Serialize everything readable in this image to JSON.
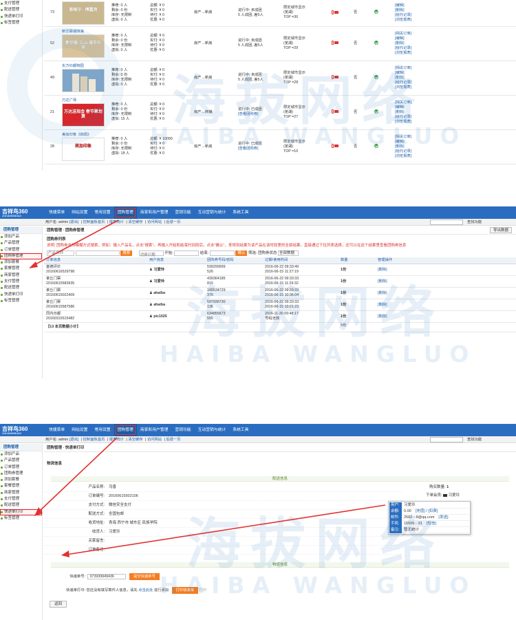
{
  "watermark": {
    "cn": "海拔网络",
    "en": "HAIBA WANGLUO"
  },
  "p1": {
    "sidebar": [
      "支付管理",
      "配送管理",
      "快递单打印",
      "标签管理"
    ],
    "rows": [
      {
        "id": "73",
        "title": "",
        "thumb_text": "恩格尔 · 傅嘉苑",
        "thumb_bg": "#c9b88f",
        "sales": [
          "推荐: 0 人",
          "剩余: 0 份",
          "库存: 无限制",
          "虚拟: 0 人"
        ],
        "money": [
          "总额: ¥ 0",
          "实付: ¥ 0",
          "待付: ¥ 0",
          "优惠: ¥ 0"
        ],
        "type": "房产→新房",
        "status": [
          "进行中: 未成团",
          "5 人成团, 差5人"
        ],
        "loc": "限定城市显示",
        "loc2": "(芜湖)",
        "top": "TOP =30",
        "flag": "否",
        "ops": [
          "编辑",
          "删除",
          "给托记录",
          "浏览报表"
        ]
      },
      {
        "id": "52",
        "title": "新华联城四海",
        "thumb_text": "新华联·三山 城市中央",
        "thumb_bg": "#d9c39a",
        "sales": [
          "推荐: 0 人",
          "剩余: 0 份",
          "库存: 无限制",
          "虚拟: 0 人"
        ],
        "money": [
          "总额: ¥ 0",
          "实付: ¥ 0",
          "待付: ¥ 0",
          "优惠: ¥ 0"
        ],
        "type": "房产→新房",
        "status": [
          "进行中: 未成团",
          "5 人成团, 差5人"
        ],
        "loc": "限定城市显示",
        "loc2": "(芜湖)",
        "top": "TOP =29",
        "flag": "否",
        "ops": [
          "相关订单",
          "编辑",
          "删除",
          "给托记录",
          "浏览报表"
        ]
      },
      {
        "id": "49",
        "title": "东方红都物园",
        "thumb_text": "",
        "thumb_bg": "#7fa6c9",
        "sales": [
          "推荐: 0 人",
          "剩余: 0 份",
          "库存: 无限制",
          "虚拟: 0 人"
        ],
        "money": [
          "总额: ¥ 0",
          "实付: ¥ 0",
          "待付: ¥ 0",
          "优惠: ¥ 0"
        ],
        "type": "房产→新房",
        "status": [
          "进行中: 未成团",
          "5 人成团, 差5人"
        ],
        "loc": "限定城市显示",
        "loc2": "(芜湖)",
        "top": "TOP =28",
        "flag": "否",
        "ops": [
          "相关订单",
          "编辑",
          "删除",
          "给托记录",
          "浏览报表"
        ]
      },
      {
        "id": "21",
        "title": "万达广场",
        "thumb_text": "万达送现金 春节聚划算",
        "thumb_bg": "#d8262b",
        "sales": [
          "推荐: 0 人",
          "剩余: 0 份",
          "库存: 无限制",
          "虚拟: 15 人"
        ],
        "money": [
          "总额: ¥ 0",
          "实付: ¥ 0",
          "待付: ¥ 0",
          "优惠: ¥ 0"
        ],
        "type": "房产→商铺",
        "status": [
          "进行中: 已成团",
          "[查看团购券]"
        ],
        "loc": "限定城市显示",
        "loc2": "(芜湖)",
        "top": "TOP =27",
        "flag": "否",
        "ops": [
          "相关订单",
          "编辑",
          "删除",
          "给托记录",
          "浏览报表"
        ]
      },
      {
        "id": "28",
        "title": "美加印象《四周》",
        "thumb_text": "美加印象",
        "thumb_bg": "#ffffff",
        "sales": [
          "推荐: 0 人",
          "剩余: 0 份",
          "库存: 无限制",
          "虚拟: 18 人"
        ],
        "money": [
          "总额: ¥ 10000",
          "实付: ¥ 0",
          "待付: ¥ 0",
          "优惠: ¥ 0"
        ],
        "type": "房产→新房",
        "status": [
          "进行中: 已成团",
          "[查看团购券]"
        ],
        "loc": "限定城市显示",
        "loc2": "(芜湖)",
        "top": "TOP =10",
        "flag": "否",
        "ops": [
          "相关订单",
          "编辑",
          "删除",
          "给托记录",
          "浏览报表"
        ]
      }
    ]
  },
  "p2": {
    "logo": "吉祥鸟360",
    "logo_sub": "JIXIANGNIAO",
    "nav": [
      "快捷菜单",
      "网站设置",
      "常用设置",
      "团购管理",
      "商家和用户管理",
      "营销功能",
      "互动营销与统计",
      "系统工具"
    ],
    "nav_active": 3,
    "subbar": {
      "user": "用户名: admin",
      "logout": "[退出]",
      "links": [
        "控制面板首页",
        "报表统计",
        "清空缓存",
        "访问网站",
        "后退一页"
      ],
      "search_btn": "查找功能"
    },
    "sidebar_title": "团购管理",
    "sidebar": [
      "添加产品",
      "产品管理",
      "订单管理",
      "团购券管理",
      "添加套餐",
      "套餐管理",
      "商家管理",
      "支付管理",
      "配送管理",
      "快递单打印",
      "标签管理"
    ],
    "sidebar_active": 3,
    "crumb": "团购管理 · 团购券管理",
    "export": "导出数据",
    "section": "团购券列表",
    "tip": "说明: 团购券支持模糊方式搜索，例如：输入产品名，点击\"搜索\"。再输入开始和结束时间段后，点击\"确认\"，来得到结果为该产品在该时段里的全部结果。直接通过下拉列表选择，还可以在这个结果里查看团购券信息",
    "filter": {
      "product": "产品名称",
      "search": "搜索",
      "expire": "消费日期",
      "start": "开始:",
      "end": "结束:",
      "confirm": "确认",
      "status": "筛选:",
      "status_label": "团购券状态",
      "all": "全部数据"
    },
    "cols": [
      "订单信息",
      "用户信息",
      "团购券号码/密码",
      "过期/使用时间",
      "数量",
      "管理操作"
    ],
    "rows": [
      {
        "title": "富德评价",
        "order": "20160616529798",
        "user": "习爱玲",
        "code": "599299999",
        "pwd": "526",
        "t1": "2016-06-22 09:33:49",
        "t2": "2016-06-15 11:27:19",
        "qty": "1份",
        "op": "[删除]"
      },
      {
        "title": "孝丘门票",
        "order": "20160615583935",
        "user": "习爱玲",
        "code": "439364185",
        "pwd": "815",
        "t1": "2016-06-22 09:33:33",
        "t2": "2016-06-15 11:29:32",
        "qty": "1份",
        "op": "[删除]"
      },
      {
        "title": "孝丘门票",
        "order": "20160615022409",
        "user": "ahaiba",
        "code": "189534729",
        "pwd": "376",
        "t1": "2016-06-22 09:33:33",
        "t2": "2016-06-15 10:36:04",
        "qty": "1份",
        "op": "[删除]"
      },
      {
        "title": "孝丘门票",
        "order": "20160615587586",
        "user": "ahaiba",
        "code": "597936730",
        "pwd": "136",
        "t1": "2016-06-22 09:33:33",
        "t2": "2016-06-15 10:21:23",
        "qty": "1份",
        "op": "[删除]"
      },
      {
        "title": "同内日都",
        "order": "20160315515482",
        "user": "pic1025",
        "code": "634855673",
        "pwd": "555",
        "t1": "2016-11-30 09:48:17",
        "t2": "号码无效",
        "qty": "1份",
        "op": "[删除]"
      }
    ],
    "footer": "【13 本页数据小计】",
    "footer_qty": "5份"
  },
  "p3": {
    "crumb": "团购管理 · 快递单打印",
    "section": "物流信息",
    "sidebar_title": "团购管理",
    "sidebar": [
      "添加产品",
      "产品管理",
      "订单管理",
      "团购券管理",
      "添加套餐",
      "套餐管理",
      "商家管理",
      "支付管理",
      "配送管理",
      "快递单打印",
      "标签管理"
    ],
    "sidebar_active": 9,
    "head": "配送信息",
    "fields": [
      {
        "label": "产品名称:",
        "value": "乌香"
      },
      {
        "label": "订单编号:",
        "value": "20160615502106"
      },
      {
        "label": "支付方式:",
        "value": "微信安全支付"
      },
      {
        "label": "配送方式:",
        "value": "全国包邮"
      },
      {
        "label": "收货地址:",
        "value": "青海 西宁市 城东区 民族学院"
      },
      {
        "label": "收货人:",
        "value": "习爱玲"
      },
      {
        "label": "买家留言:",
        "value": ""
      },
      {
        "label": "订单备注:",
        "value": ""
      }
    ],
    "right": {
      "buy_qty_label": "购买数量:",
      "buy_qty": "1",
      "member_label": "下单会员:",
      "member": "习爱玲"
    },
    "popup": [
      {
        "k": "用户:",
        "v": "习爱玲",
        "a": ""
      },
      {
        "k": "余额:",
        "v": "0.00",
        "a": "[充值] / [扣费]"
      },
      {
        "k": "邮件:",
        "v": "2582···8@qq.com",
        "a": "[发送]"
      },
      {
        "k": "手机:",
        "v": "15506···31",
        "a": "[短信]"
      },
      {
        "k": "备注:",
        "v": "暂无统计",
        "a": ""
      }
    ],
    "logistics": "物流信息",
    "ship_label": "快递单号:",
    "ship_no": "373939949436",
    "ship_btn": "提交快递单号",
    "print_label": "快递单打印:",
    "print_tip": "您还没有填写寄件人信息，请先",
    "print_link": "点击此处",
    "print_tip2": "进行添加",
    "print_btn": "打印快递单",
    "print_btn2": "打印",
    "back": "返回"
  }
}
